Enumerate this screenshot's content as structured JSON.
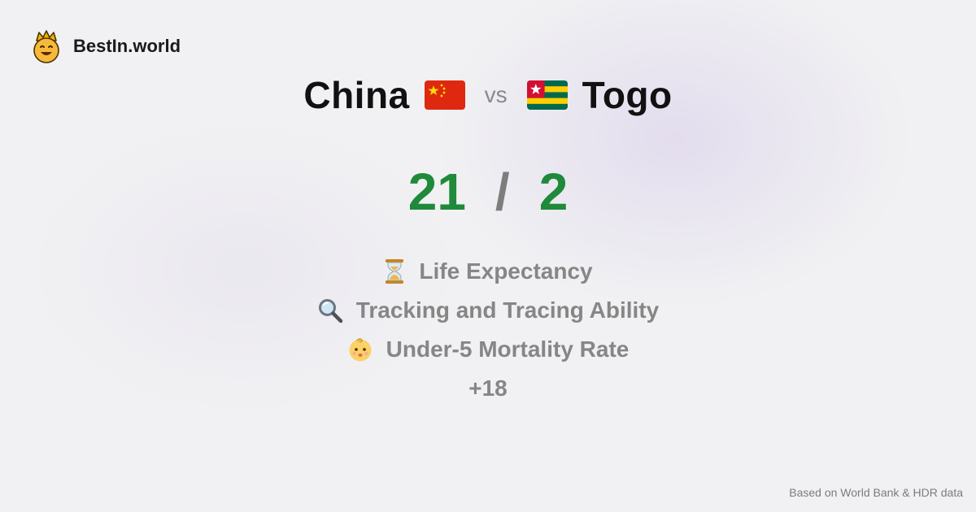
{
  "brand": {
    "name": "BestIn.world",
    "icon": "crown-smiley-icon"
  },
  "comparison": {
    "left": {
      "name": "China",
      "flag": "china-flag-icon"
    },
    "vs_label": "vs",
    "right": {
      "name": "Togo",
      "flag": "togo-flag-icon"
    }
  },
  "score": {
    "left": "21",
    "separator": "/",
    "right": "2",
    "color": "#1f8a3a"
  },
  "metrics": [
    {
      "icon": "hourglass-icon",
      "label": "Life Expectancy"
    },
    {
      "icon": "magnifier-icon",
      "label": "Tracking and Tracing Ability"
    },
    {
      "icon": "baby-face-icon",
      "label": "Under-5 Mortality Rate"
    }
  ],
  "more_count": "+18",
  "footer": {
    "note": "Based on World Bank & HDR data"
  }
}
